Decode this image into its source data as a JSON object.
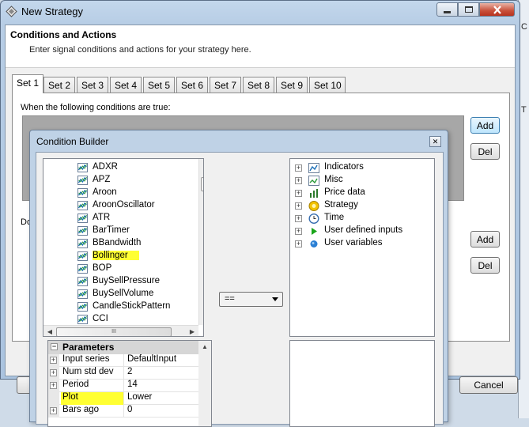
{
  "window": {
    "title": "New Strategy",
    "header_title": "Conditions and Actions",
    "header_subtitle": "Enter signal conditions and actions for your strategy here.",
    "side_glyphs": [
      "C",
      "T"
    ]
  },
  "tabs": [
    "Set 1",
    "Set 2",
    "Set 3",
    "Set 4",
    "Set 5",
    "Set 6",
    "Set 7",
    "Set 8",
    "Set 9",
    "Set 10"
  ],
  "active_tab": "Set 1",
  "conditions_label": "When the following conditions are true:",
  "do_label": "Do",
  "buttons": {
    "add": "Add",
    "del": "Del",
    "cancel": "Cancel"
  },
  "condition_builder": {
    "title": "Condition Builder",
    "close_glyph": "✕",
    "indicators": [
      "ADXR",
      "APZ",
      "Aroon",
      "AroonOscillator",
      "ATR",
      "BarTimer",
      "BBandwidth",
      "Bollinger",
      "BOP",
      "BuySellPressure",
      "BuySellVolume",
      "CandleStickPattern",
      "CCI"
    ],
    "highlighted_indicator": "Bollinger",
    "operator": "==",
    "scroll_glyphs": {
      "up": "▲",
      "down": "▼",
      "left": "◀",
      "right": "▶",
      "grip": "III"
    },
    "tree": [
      {
        "label": "Indicators",
        "icon": "indicator-chart-icon"
      },
      {
        "label": "Misc",
        "icon": "misc-chart-icon"
      },
      {
        "label": "Price data",
        "icon": "price-bars-icon"
      },
      {
        "label": "Strategy",
        "icon": "strategy-icon"
      },
      {
        "label": "Time",
        "icon": "clock-icon"
      },
      {
        "label": "User defined inputs",
        "icon": "play-arrow-icon"
      },
      {
        "label": "User variables",
        "icon": "blue-dot-icon"
      }
    ],
    "parameters": {
      "category": "Parameters",
      "rows": [
        {
          "name": "Input series",
          "value": "DefaultInput",
          "expandable": true
        },
        {
          "name": "Num std dev",
          "value": "2",
          "expandable": true
        },
        {
          "name": "Period",
          "value": "14",
          "expandable": true
        },
        {
          "name": "Plot",
          "value": "Lower",
          "expandable": false,
          "highlight": true
        },
        {
          "name": "Bars ago",
          "value": "0",
          "expandable": true
        }
      ]
    }
  },
  "colors": {
    "highlight": "#ffff33",
    "title_bar": "#b7cde5",
    "close_button": "#c8503a"
  }
}
